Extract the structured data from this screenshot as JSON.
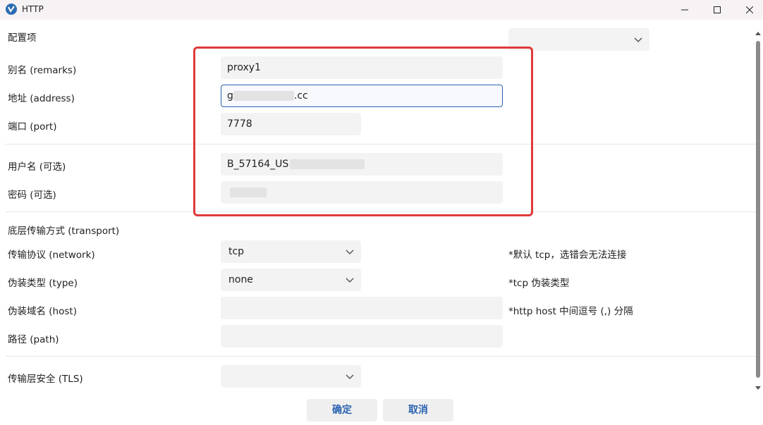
{
  "window": {
    "title": "HTTP"
  },
  "config": {
    "label": "配置项",
    "value": ""
  },
  "fields": {
    "remarks": {
      "label": "别名 (remarks)",
      "value": "proxy1"
    },
    "address_label": "地址 (address)",
    "address_prefix": "g",
    "address_suffix": ".cc",
    "port": {
      "label": "端口 (port)",
      "value": "7778"
    },
    "username_label": "用户名 (可选)",
    "username_prefix": "B_57164_US",
    "password_label": "密码 (可选)"
  },
  "transport": {
    "section_label": "底层传输方式 (transport)",
    "network": {
      "label": "传输协议 (network)",
      "value": "tcp",
      "note": "*默认 tcp，选错会无法连接"
    },
    "type": {
      "label": "伪装类型 (type)",
      "value": "none",
      "note": "*tcp 伪装类型"
    },
    "host": {
      "label": "伪装域名 (host)",
      "value": "",
      "note": "*http host 中间逗号 (,) 分隔"
    },
    "path": {
      "label": "路径 (path)",
      "value": ""
    }
  },
  "tls": {
    "label": "传输层安全 (TLS)",
    "value": ""
  },
  "buttons": {
    "ok": "确定",
    "cancel": "取消"
  },
  "colors": {
    "accent": "#2b62b0",
    "highlight_box": "#e03a3a"
  }
}
